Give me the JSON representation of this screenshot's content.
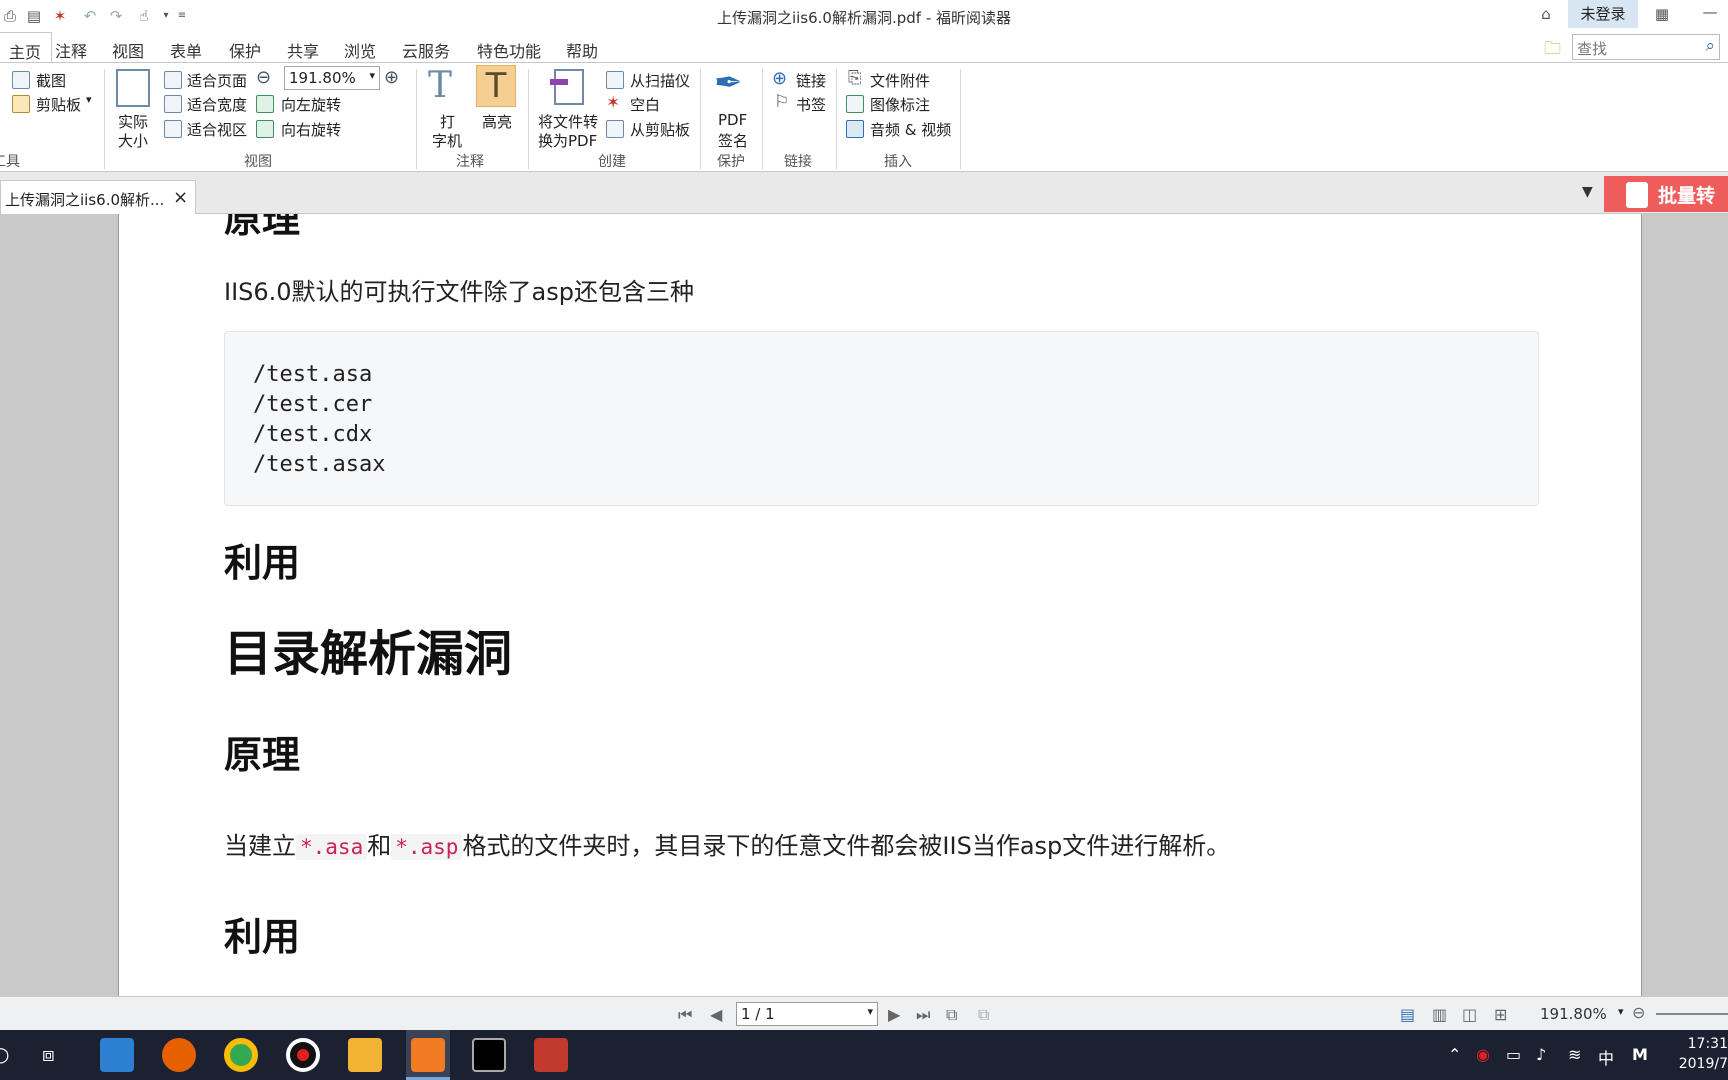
{
  "window": {
    "title": "上传漏洞之iis6.0解析漏洞.pdf - 福昕阅读器",
    "login_label": "未登录"
  },
  "menu": {
    "tabs": [
      "主页",
      "注释",
      "视图",
      "表单",
      "保护",
      "共享",
      "浏览",
      "云服务",
      "特色功能",
      "帮助"
    ]
  },
  "search": {
    "placeholder": "查找"
  },
  "ribbon": {
    "tools": {
      "screenshot": "截图",
      "clipboard": "剪贴板",
      "group": "工具"
    },
    "view": {
      "actual_size_line1": "实际",
      "actual_size_line2": "大小",
      "fit_page": "适合页面",
      "fit_width": "适合宽度",
      "fit_view": "适合视区",
      "zoom": "191.80%",
      "rotate_left": "向左旋转",
      "rotate_right": "向右旋转",
      "group": "视图"
    },
    "annotate": {
      "typewriter_line1": "打",
      "typewriter_line2": "字机",
      "highlight": "高亮",
      "group": "注释"
    },
    "create": {
      "convert_line1": "将文件转",
      "convert_line2": "换为PDF",
      "from_scanner": "从扫描仪",
      "blank": "空白",
      "from_clipboard": "从剪贴板",
      "group": "创建"
    },
    "protect": {
      "sign_line1": "PDF",
      "sign_line2": "签名",
      "group": "保护"
    },
    "links": {
      "link": "链接",
      "bookmark": "书签",
      "group": "链接"
    },
    "insert": {
      "attachment": "文件附件",
      "image_annotation": "图像标注",
      "audio_video": "音频 & 视频",
      "group": "插入"
    }
  },
  "doc_tab": {
    "label": "上传漏洞之iis6.0解析...",
    "close": "×"
  },
  "banner": {
    "label": "批量转"
  },
  "document": {
    "heading_top": "原理",
    "para1": "IIS6.0默认的可执行文件除了asp还包含三种",
    "code_lines": [
      "/test.asa",
      "/test.cer",
      "/test.cdx",
      "/test.asax"
    ],
    "heading_use1": "利用",
    "title_dir": "目录解析漏洞",
    "heading_principle2": "原理",
    "para2_prefix": "当建立",
    "para2_code1": "*.asa",
    "para2_mid": "和",
    "para2_code2": "*.asp",
    "para2_suffix": "格式的文件夹时，其目录下的任意文件都会被IIS当作asp文件进行解析。",
    "heading_use2": "利用"
  },
  "statusbar": {
    "page": "1 / 1",
    "zoom": "191.80%"
  },
  "taskbar": {
    "ime": "中",
    "input_mode": "M",
    "time": "17:31",
    "date": "2019/7"
  }
}
